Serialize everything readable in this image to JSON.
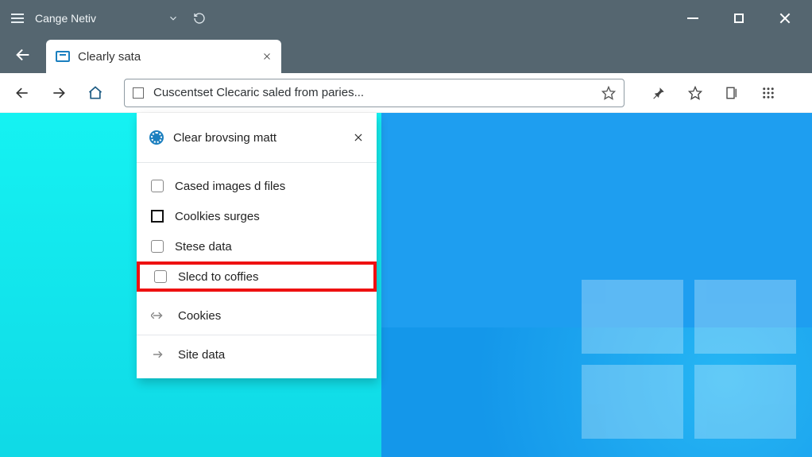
{
  "window": {
    "title": "Cange Netiv"
  },
  "tab": {
    "title": "Clearly sata"
  },
  "address": {
    "text": "Cuscentset Clecaric saled from paries..."
  },
  "panel": {
    "title": "Clear brovsing matt",
    "items": [
      {
        "label": "Cased images d files"
      },
      {
        "label": "Coolkies surges"
      },
      {
        "label": "Stese data"
      },
      {
        "label": "Slecd to coffies"
      }
    ],
    "cookies": "Cookies",
    "sitedata": "Site data"
  }
}
